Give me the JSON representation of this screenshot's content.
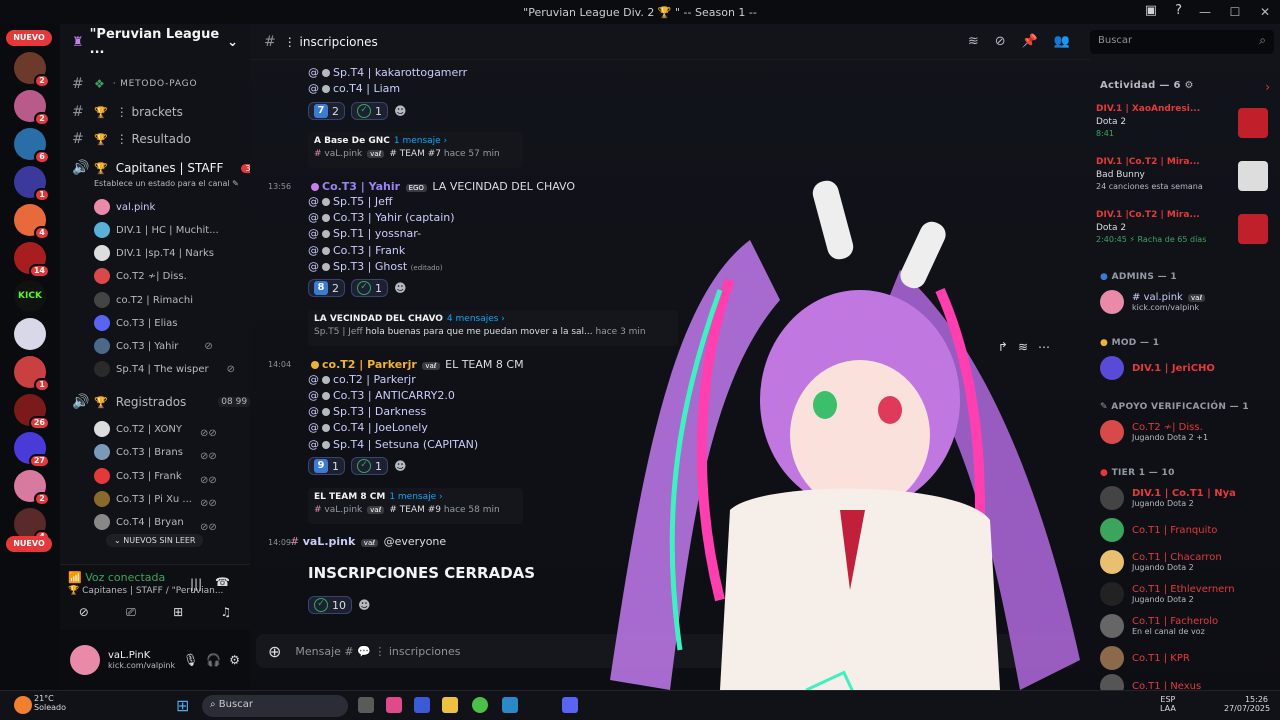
{
  "window": {
    "title": "\"Peruvian League Div. 2 🏆 \" -- Season 1 --"
  },
  "guilds": {
    "nuevo_top": "NUEVO",
    "nuevo_bottom": "NUEVO",
    "badges": [
      "2",
      "5",
      "2",
      "6",
      "1",
      "4",
      "14",
      "1",
      "26",
      "27",
      "2",
      "4"
    ],
    "kick_label": "KICK"
  },
  "sidebar": {
    "server_name": "\"Peruvian League ...",
    "channels": [
      {
        "label": "⋅ metodo-pago"
      },
      {
        "label": "⋮ brackets"
      },
      {
        "label": "⋮ Resultado"
      }
    ],
    "voice1": {
      "label": "Capitanes | STAFF",
      "badge": "3",
      "status": "Establece un estado para el canal ✎",
      "users": [
        "val.pink",
        "DIV.1 | HC | Muchit...",
        "DIV.1 |sp.T4 | Narks",
        "Co.T2 ≁| Diss.",
        "co.T2 | Rimachi",
        "Co.T3 | Elias",
        "Co.T3 | Yahir",
        "Sp.T4 | The wisper"
      ]
    },
    "voice2": {
      "label": "Registrados",
      "count_a": "08",
      "count_b": "99",
      "users": [
        "Co.T2 | XONY",
        "Co.T3 | Brans",
        "Co.T3 | Frank",
        "Co.T3 | Pi Xu ...",
        "Co.T4 | Bryan"
      ]
    },
    "unread_pill": "NUEVOS SIN LEER",
    "voice_panel": {
      "title": "Voz conectada",
      "subtitle": "Capitanes | STAFF / \"Peruvian..."
    },
    "user": {
      "name": "vaL.PinK",
      "status": "kick.com/valpink"
    }
  },
  "header": {
    "channel": "⋮ inscripciones",
    "search_placeholder": "Buscar"
  },
  "chat": {
    "top_lines": [
      "Sp.T4 | kakarottogamerr",
      "co.T4 | Liam"
    ],
    "react1": {
      "num": "7",
      "count": "2",
      "check": "1"
    },
    "thread1": {
      "name": "A Base De GNC",
      "count": "1 mensaje ›",
      "author": "vaL.pink",
      "text": "# TEAM #7",
      "time": "hace 57 min"
    },
    "msg2": {
      "time": "13:56",
      "user": "Co.T3 | Yahir",
      "tag": "EGO",
      "title": "LA VECINDAD DEL CHAVO",
      "lines": [
        "Sp.T5 | Jeff",
        "Co.T3 | Yahir (captain)",
        "Sp.T1 | yossnar-",
        "Co.T3 | Frank",
        "Sp.T3 | Ghost"
      ],
      "edited": "(editado)"
    },
    "react2": {
      "num": "8",
      "count": "2",
      "check": "1"
    },
    "thread2": {
      "name": "LA VECINDAD DEL CHAVO",
      "count": "4 mensajes ›",
      "author": "Sp.T5 | Jeff",
      "text": "hola buenas para que me puedan mover a la sal...",
      "time": "hace 3 min"
    },
    "msg3": {
      "time": "14:04",
      "user": "co.T2 | Parkerjr",
      "title": "EL TEAM 8 CM",
      "lines": [
        "co.T2 | Parkerjr",
        "Co.T3 | ANTICARRY2.0",
        "Sp.T3 | Darkness",
        "Co.T4 | JoeLonely",
        "Sp.T4 | Setsuna (CAPITAN)"
      ]
    },
    "react3": {
      "num": "9",
      "count": "1",
      "check": "1"
    },
    "thread3": {
      "name": "EL TEAM 8 CM",
      "count": "1 mensaje ›",
      "author": "vaL.pink",
      "text": "# TEAM #9",
      "time": "hace 58 min"
    },
    "msg4": {
      "time": "14:09",
      "user": "vaL.pink",
      "mention": "@everyone",
      "big": "INSCRIPCIONES CERRADAS",
      "check": "10"
    },
    "composer_placeholder": "Mensaje # 💬 ⋮ inscripciones"
  },
  "members": {
    "activity_title": "Actividad — 6",
    "activities": [
      {
        "name": "DIV.1 | XaoAndresi...",
        "game": "Dota 2",
        "time": "8:41"
      },
      {
        "name": "DIV.1 |Co.T2 | Mira...",
        "game": "Bad Bunny",
        "time": "24 canciones esta semana"
      },
      {
        "name": "DIV.1 |Co.T2 | Mira...",
        "game": "Dota 2",
        "time": "2:40:45  ⚡ Racha de 65 días"
      }
    ],
    "admins": {
      "title": "ADMINS — 1",
      "name": "val.pink",
      "status": "kick.com/valpink"
    },
    "mod": {
      "title": "MOD — 1",
      "name": "DIV.1 | JeriCHO"
    },
    "apoyo": {
      "title": "APOYO VERIFICACIÓN — 1",
      "name": "Co.T2 ≁| Diss.",
      "status": "Jugando Dota 2 +1"
    },
    "tier": {
      "title": "TIER 1 — 10",
      "list": [
        {
          "name": "DIV.1 | Co.T1 | Nya",
          "status": "Jugando Dota 2"
        },
        {
          "name": "Co.T1 | Franquito",
          "status": ""
        },
        {
          "name": "Co.T1 | Chacarron",
          "status": "Jugando Dota 2"
        },
        {
          "name": "Co.T1 | Ethlevernern",
          "status": "Jugando Dota 2"
        },
        {
          "name": "Co.T1 | Facherolo",
          "status": "En el canal de voz"
        },
        {
          "name": "Co.T1 | KPR",
          "status": ""
        },
        {
          "name": "Co.T1 | Nexus",
          "status": ""
        }
      ]
    }
  },
  "taskbar": {
    "weather_temp": "21°C",
    "weather_desc": "Soleado",
    "search": "Buscar",
    "lang1": "ESP",
    "lang2": "LAA",
    "time": "15:26",
    "date": "27/07/2025"
  }
}
